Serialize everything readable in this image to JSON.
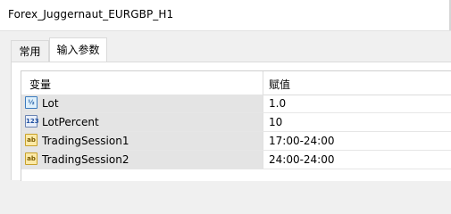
{
  "window": {
    "title": "Forex_Juggernaut_EURGBP_H1"
  },
  "tabs": [
    {
      "label": "常用",
      "active": false
    },
    {
      "label": "输入参数",
      "active": true
    }
  ],
  "table": {
    "headers": {
      "variable": "变量",
      "value": "赋值"
    },
    "rows": [
      {
        "icon": "real-number-icon",
        "icon_text": "½",
        "name": "Lot",
        "value": "1.0"
      },
      {
        "icon": "integer-icon",
        "icon_text": "123",
        "name": "LotPercent",
        "value": "10"
      },
      {
        "icon": "string-icon",
        "icon_text": "ab",
        "name": "TradingSession1",
        "value": "17:00-24:00"
      },
      {
        "icon": "string-icon",
        "icon_text": "ab",
        "name": "TradingSession2",
        "value": "24:00-24:00"
      }
    ]
  },
  "colors": {
    "name_cell_bg": "#e4e4e4",
    "active_tab_bg": "#ffffff",
    "window_bg": "#f0f0f0"
  }
}
